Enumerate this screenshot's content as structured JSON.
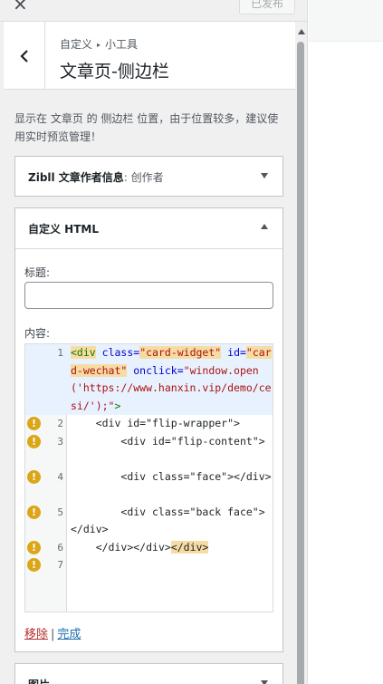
{
  "topbar": {
    "close_icon": "close-icon",
    "publish_label": "已发布"
  },
  "section": {
    "breadcrumb_root": "自定义",
    "breadcrumb_child": "小工具",
    "title": "文章页-侧边栏",
    "back_icon": "chevron-left-icon"
  },
  "description": "显示在 文章页 的 侧边栏 位置，由于位置较多，建议使用实时预览管理！",
  "widgets": {
    "author": {
      "title": "Zibll 文章作者信息",
      "subtitle": ": 创作者",
      "state": "collapsed"
    },
    "html": {
      "title": "自定义 HTML",
      "state": "expanded",
      "title_label": "标题:",
      "title_value": "",
      "content_label": "内容:",
      "remove_label": "移除",
      "separator": "|",
      "done_label": "完成"
    },
    "image": {
      "title": "图片",
      "state": "collapsed"
    }
  },
  "editor": {
    "lines": [
      {
        "number": "1",
        "warning": false,
        "highlighted": true
      },
      {
        "number": "2",
        "warning": true
      },
      {
        "number": "3",
        "warning": true
      },
      {
        "number": "4",
        "warning": true
      },
      {
        "number": "5",
        "warning": true
      },
      {
        "number": "6",
        "warning": true
      },
      {
        "number": "7",
        "warning": true
      }
    ],
    "code": {
      "l1_tag": "<div",
      "l1_attr1": "class=",
      "l1_val1": "\"card-widget\"",
      "l1_attr2": "id=",
      "l1_val2": "\"card-wechat\"",
      "l1_attr3": "onclick=",
      "l1_val3": "\"window.open('https://www.hanxin.vip/demo/cesi/');\"",
      "l1_end": ">",
      "l2": "    <div id=\"flip-wrapper\">",
      "l3": "        <div id=\"flip-content\">",
      "l4": "        <div class=\"face\"></div>",
      "l5": "        <div class=\"back face\"></div>",
      "l6_a": "    </div></div>",
      "l6_b": "</div>",
      "warning_glyph": "!"
    }
  },
  "colors": {
    "accent": "#2271b1",
    "danger": "#b32d2e",
    "warning": "#dba617"
  }
}
